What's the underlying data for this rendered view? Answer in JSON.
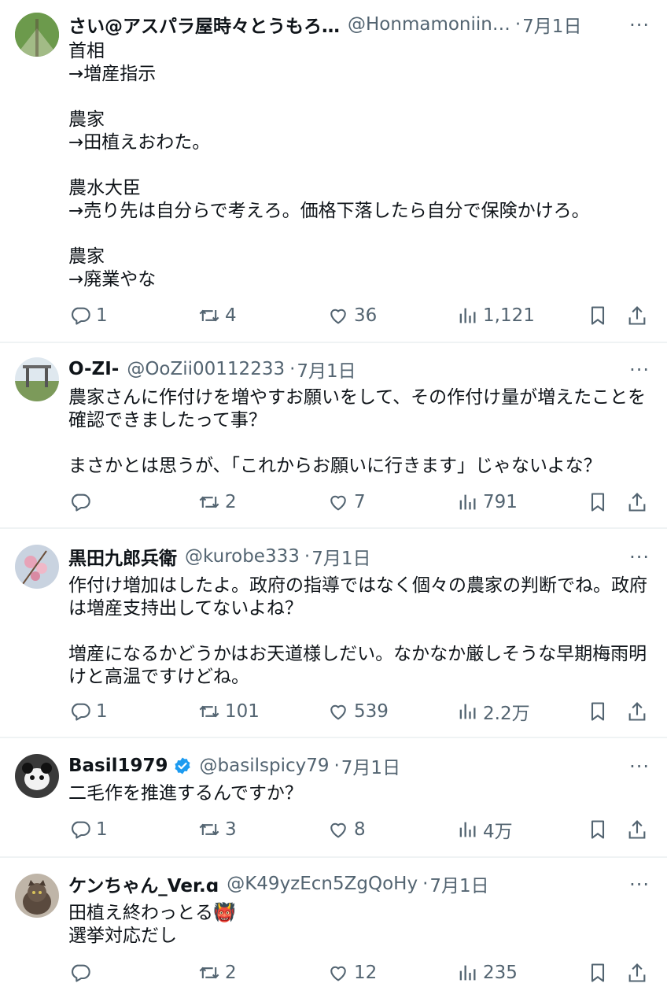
{
  "tweets": [
    {
      "name": "さい@アスパラ屋時々とうもろ…",
      "handle": "@Honmamoniin…",
      "date": "7月1日",
      "text": "首相\n→増産指示\n\n農家\n→田植えおわた。\n\n農水大臣\n→売り先は自分らで考えろ。価格下落したら自分で保険かけろ。\n\n農家\n→廃業やな",
      "replies": "1",
      "retweets": "4",
      "likes": "36",
      "views": "1,121",
      "verified": false
    },
    {
      "name": "O-ZI-",
      "handle": "@OoZii00112233",
      "date": "7月1日",
      "text": "農家さんに作付けを増やすお願いをして、その作付け量が増えたことを確認できましたって事？\n\nまさかとは思うが、「これからお願いに行きます」じゃないよな？",
      "replies": "",
      "retweets": "2",
      "likes": "7",
      "views": "791",
      "verified": false
    },
    {
      "name": "黒田九郎兵衛",
      "handle": "@kurobe333",
      "date": "7月1日",
      "text": "作付け増加はしたよ。政府の指導ではなく個々の農家の判断でね。政府は増産支持出してないよね？\n\n増産になるかどうかはお天道様しだい。なかなか厳しそうな早期梅雨明けと高温ですけどね。",
      "replies": "1",
      "retweets": "101",
      "likes": "539",
      "views": "2.2万",
      "verified": false
    },
    {
      "name": "Basil1979",
      "handle": "@basilspicy79",
      "date": "7月1日",
      "text": "二毛作を推進するんですか？",
      "replies": "1",
      "retweets": "3",
      "likes": "8",
      "views": "4万",
      "verified": true
    },
    {
      "name": "ケンちゃん_Ver.ɑ",
      "handle": "@K49yzEcn5ZgQoHy",
      "date": "7月1日",
      "text": "田植え終わっとる👹\n選挙対応だし",
      "replies": "",
      "retweets": "2",
      "likes": "12",
      "views": "235",
      "verified": false
    }
  ],
  "ui": {
    "dot": "·",
    "more": "···"
  },
  "colors": {
    "text": "#0f1419",
    "secondary": "#536471",
    "divider": "#eff3f4",
    "verified": "#1d9bf0"
  }
}
